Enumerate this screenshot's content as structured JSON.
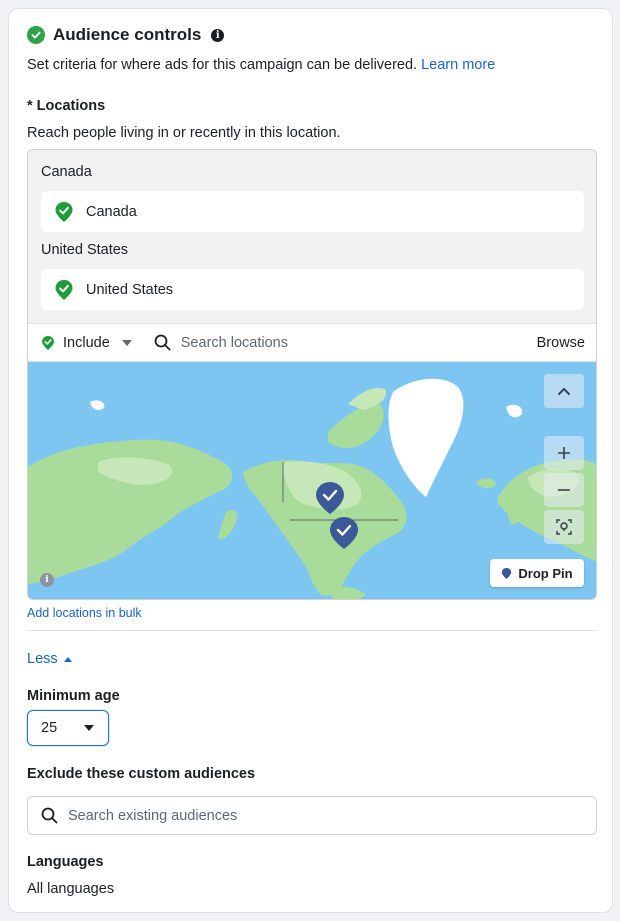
{
  "header": {
    "title": "Audience controls",
    "description": "Set criteria for where ads for this campaign can be delivered.",
    "learn_more": "Learn more"
  },
  "locations": {
    "title": "* Locations",
    "subtitle": "Reach people living in or recently in this location.",
    "groups": [
      {
        "label": "Canada",
        "item": "Canada"
      },
      {
        "label": "United States",
        "item": "United States"
      }
    ],
    "include_label": "Include",
    "search_placeholder": "Search locations",
    "browse_label": "Browse",
    "drop_pin_label": "Drop Pin",
    "bulk_link": "Add locations in bulk"
  },
  "less_label": "Less",
  "min_age": {
    "label": "Minimum age",
    "value": "25"
  },
  "exclude": {
    "label": "Exclude these custom audiences",
    "placeholder": "Search existing audiences"
  },
  "languages": {
    "label": "Languages",
    "value": "All languages"
  },
  "colors": {
    "accent": "#1b64c7",
    "success": "#31a24c",
    "pin": "#3b5998",
    "map_water": "#7ec6f2",
    "map_land": "#a9dc9b"
  }
}
